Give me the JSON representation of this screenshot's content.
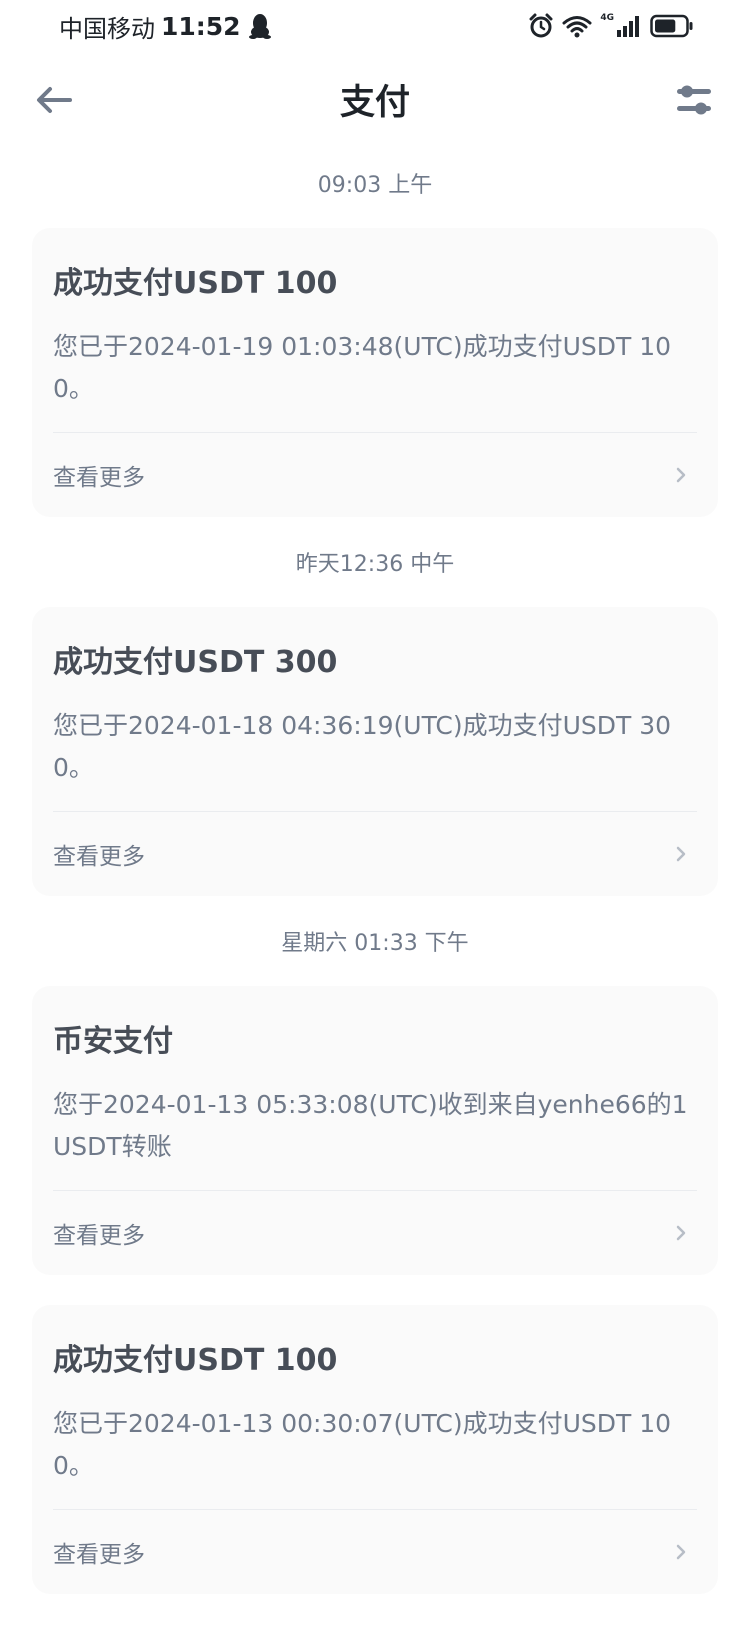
{
  "status_bar": {
    "carrier": "中国移动",
    "time": "11:52",
    "network": "4G",
    "battery_percent": 70
  },
  "nav": {
    "title": "支付"
  },
  "feed": [
    {
      "time": "09:03 上午",
      "title": "成功支付USDT 100",
      "body": "您已于2024-01-19 01:03:48(UTC)成功支付USDT 100。",
      "more": "查看更多"
    },
    {
      "time": "昨天12:36 中午",
      "title": "成功支付USDT 300",
      "body": "您已于2024-01-18 04:36:19(UTC)成功支付USDT 300。",
      "more": "查看更多"
    },
    {
      "time": "星期六 01:33 下午",
      "title": "币安支付",
      "body": "您于2024-01-13 05:33:08(UTC)收到来自yenhe66的1 USDT转账",
      "more": "查看更多"
    },
    {
      "time": "",
      "title": "成功支付USDT 100",
      "body": "您已于2024-01-13 00:30:07(UTC)成功支付USDT 100。",
      "more": "查看更多"
    }
  ],
  "colors": {
    "card_bg": "#fafafa",
    "title_text": "#474d57",
    "secondary_text": "#707a8a",
    "divider": "#eaecef"
  }
}
